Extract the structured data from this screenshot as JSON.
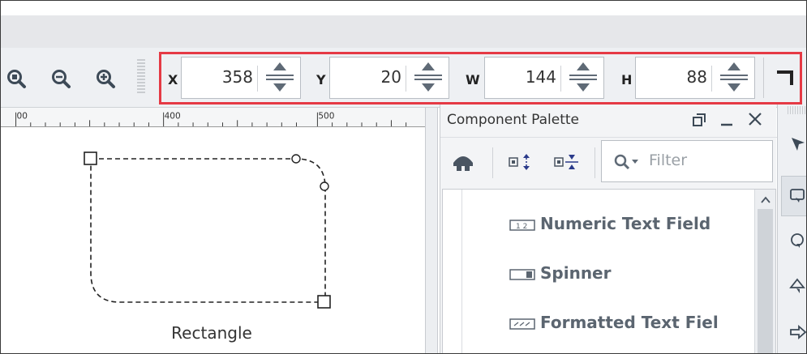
{
  "toolbar": {
    "zoom_icons": [
      "zoom-fit-icon",
      "zoom-out-icon",
      "zoom-in-icon"
    ],
    "fields": [
      {
        "label": "X",
        "value": "358"
      },
      {
        "label": "Y",
        "value": "20"
      },
      {
        "label": "W",
        "value": "144"
      },
      {
        "label": "H",
        "value": "88"
      }
    ],
    "highlight_color": "#e53a45"
  },
  "ruler": {
    "labels": [
      "00",
      "400",
      "500"
    ]
  },
  "canvas": {
    "shape_caption": "Rectangle"
  },
  "palette": {
    "title": "Component Palette",
    "filter_placeholder": "Filter",
    "items": [
      {
        "label": "Numeric Text Field",
        "icon": "numeric-text-field-icon"
      },
      {
        "label": "Spinner",
        "icon": "spinner-icon"
      },
      {
        "label": "Formatted Text Fiel",
        "icon": "formatted-text-field-icon"
      }
    ]
  }
}
